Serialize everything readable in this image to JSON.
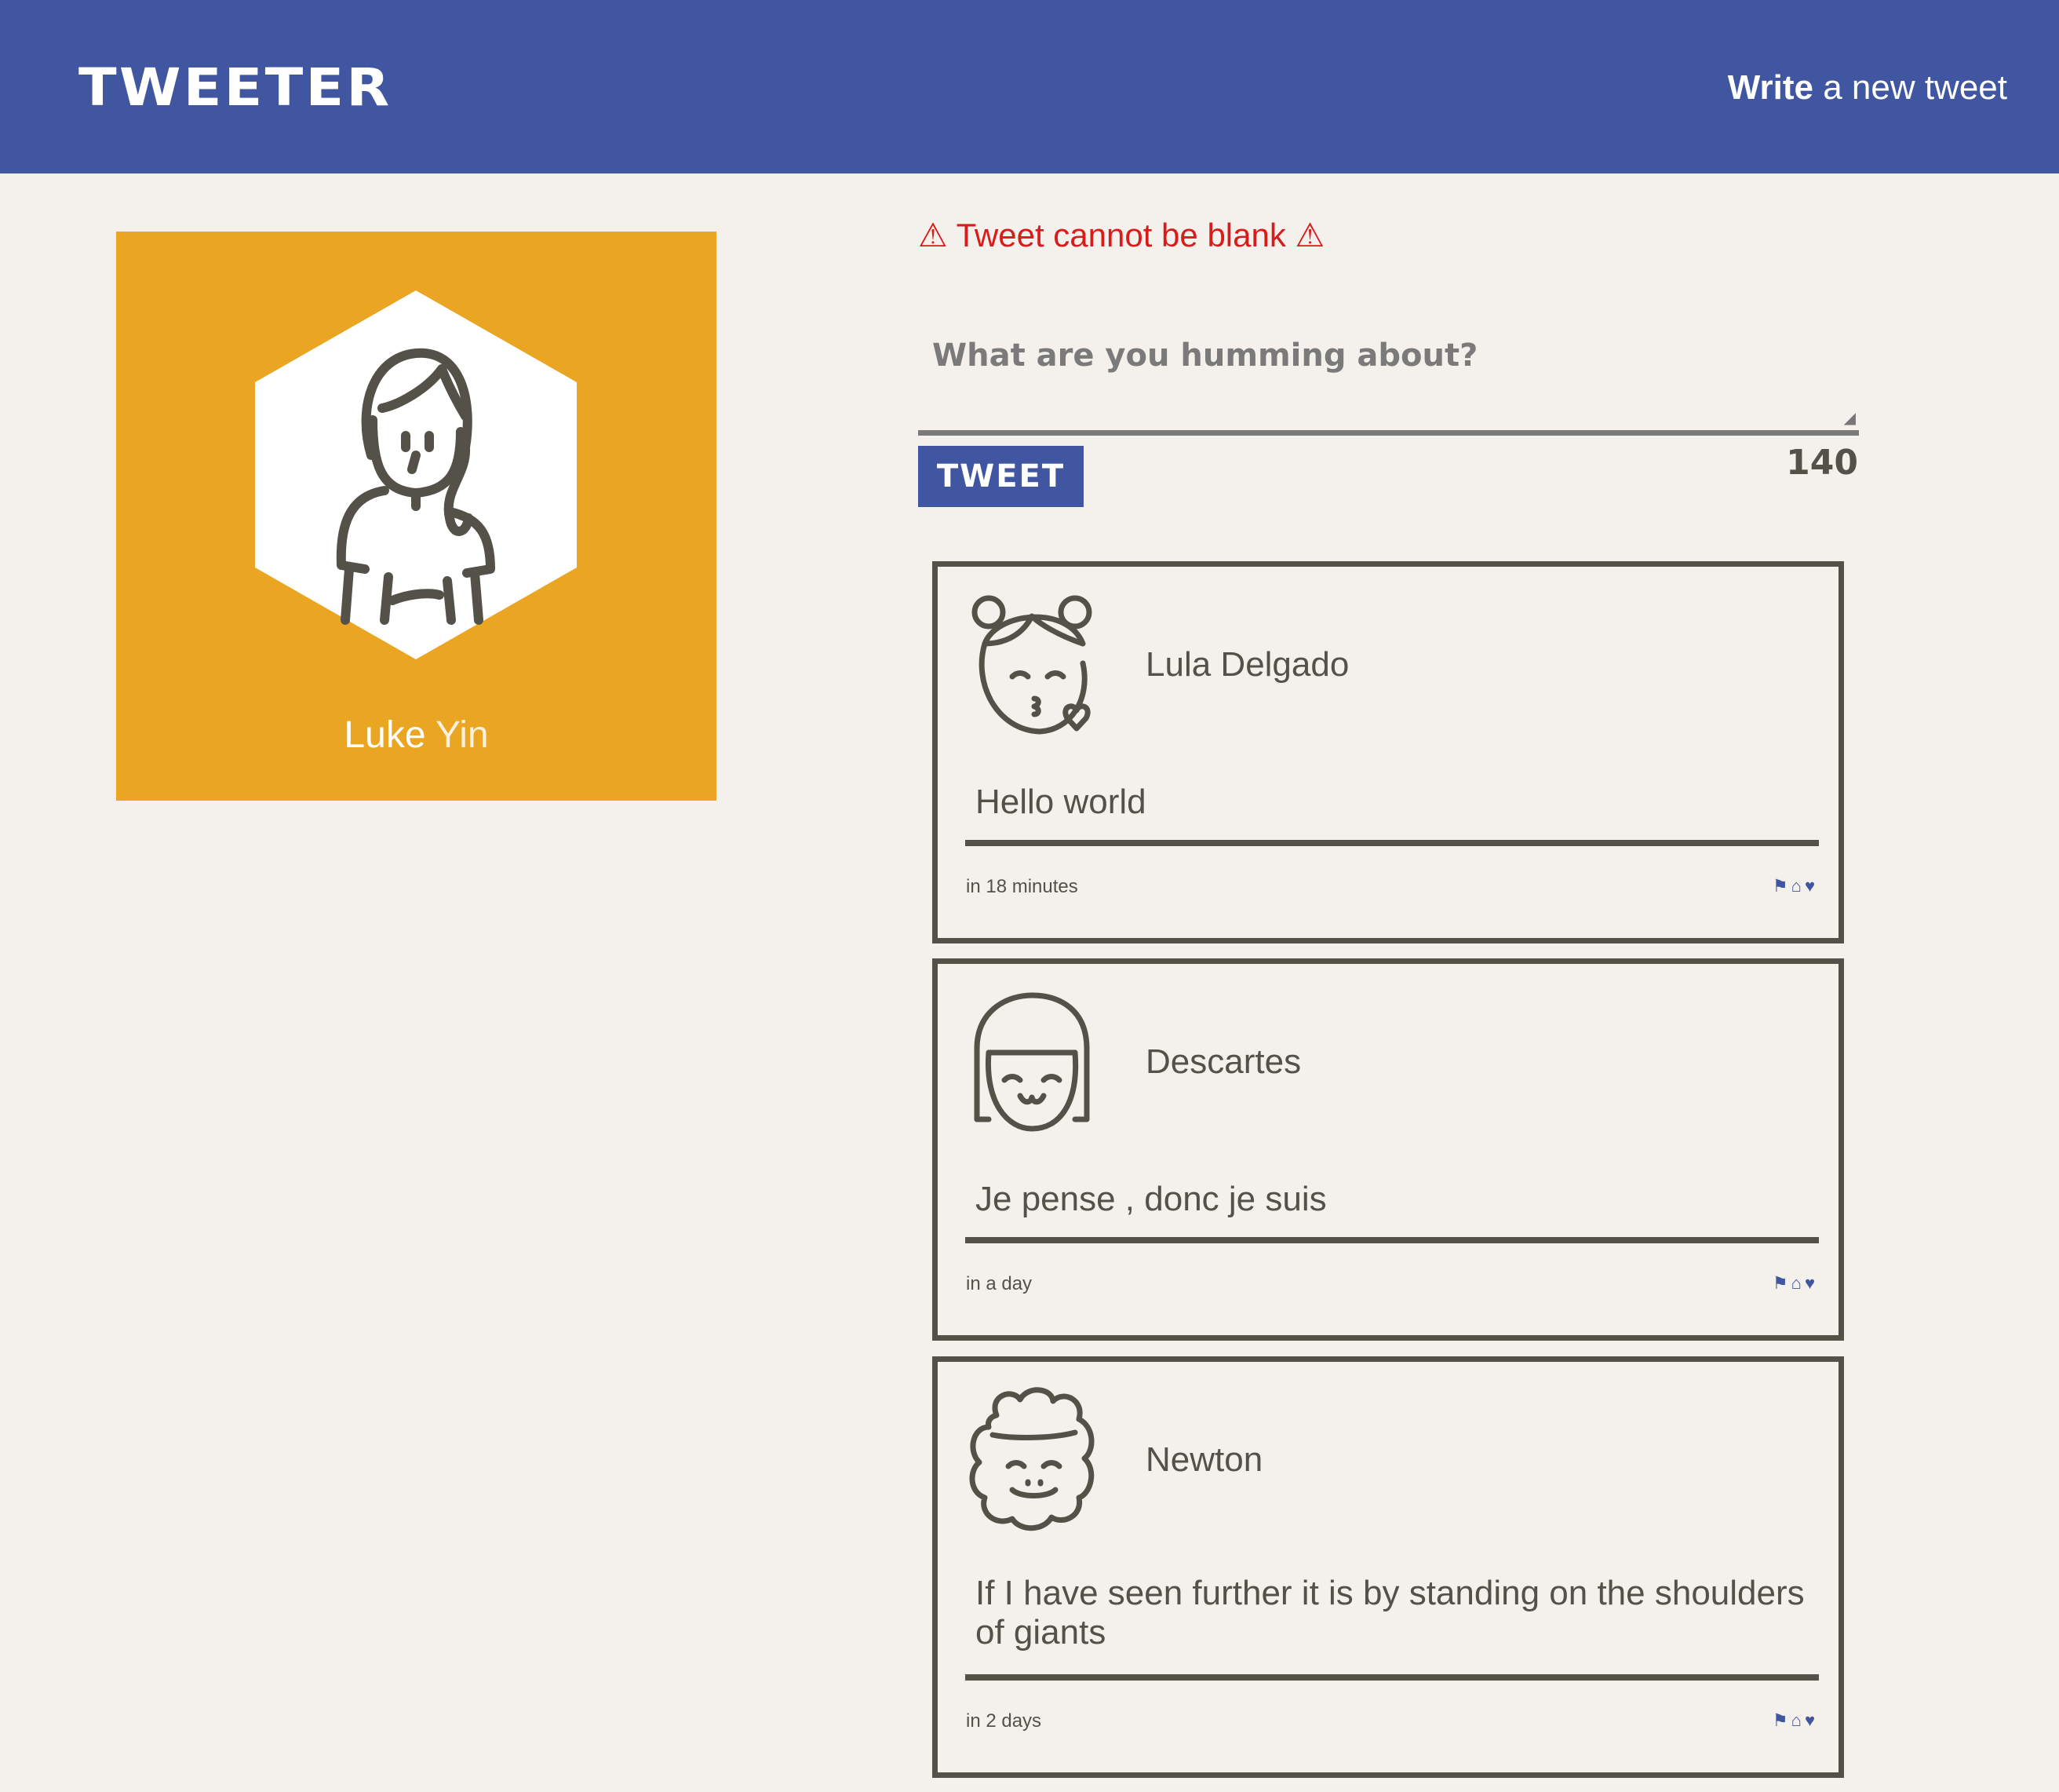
{
  "header": {
    "logo": "TWEETER",
    "write_bold": "Write",
    "write_rest": " a new tweet"
  },
  "profile": {
    "first_name": "Luke",
    "last_name": "Yin"
  },
  "compose": {
    "error": "⚠ Tweet cannot be blank ⚠",
    "placeholder": "What are you humming about?",
    "button": "TWEET",
    "counter": "140"
  },
  "tweets": [
    {
      "author": "Lula Delgado",
      "text": "Hello world",
      "time": "in 18 minutes"
    },
    {
      "author": "Descartes",
      "text": "Je pense , donc je suis",
      "time": "in a day"
    },
    {
      "author": "Newton",
      "text": "If I have seen further it is by standing on the shoulders of giants",
      "time": "in 2 days"
    }
  ],
  "icons": {
    "flag": "⚑",
    "retweet": "⌂",
    "like": "♥"
  },
  "colors": {
    "header": "#4056a1",
    "profile_bg": "#eaa522",
    "page_bg": "#f4f1ec",
    "error": "#d81c1c",
    "text": "#545149"
  }
}
